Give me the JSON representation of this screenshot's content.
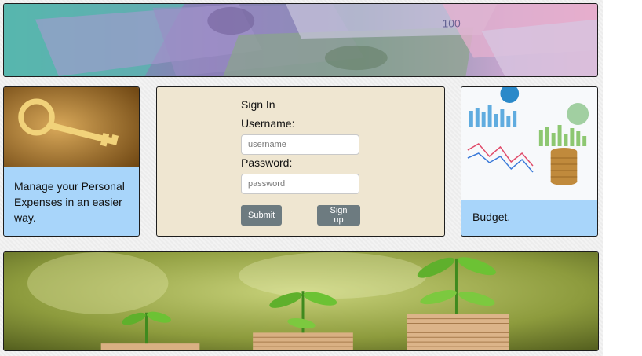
{
  "banners": {
    "top_image": "money-banner-image",
    "bottom_image": "plants-on-coins-image"
  },
  "left_card": {
    "image": "golden-key-finance-image",
    "text": "Manage your Personal Expenses in an easier way."
  },
  "signin": {
    "title": "Sign In",
    "username_label": "Username:",
    "username_placeholder": "username",
    "username_value": "",
    "password_label": "Password:",
    "password_placeholder": "password",
    "password_value": "",
    "submit_label": "Submit",
    "signup_label": "Sign up"
  },
  "right_card": {
    "image": "charts-and-coins-image",
    "text": "Budget."
  },
  "colors": {
    "card_blue": "#a8d5fa",
    "signin_bg": "#efe6d1",
    "button_bg": "#6d7b80"
  }
}
